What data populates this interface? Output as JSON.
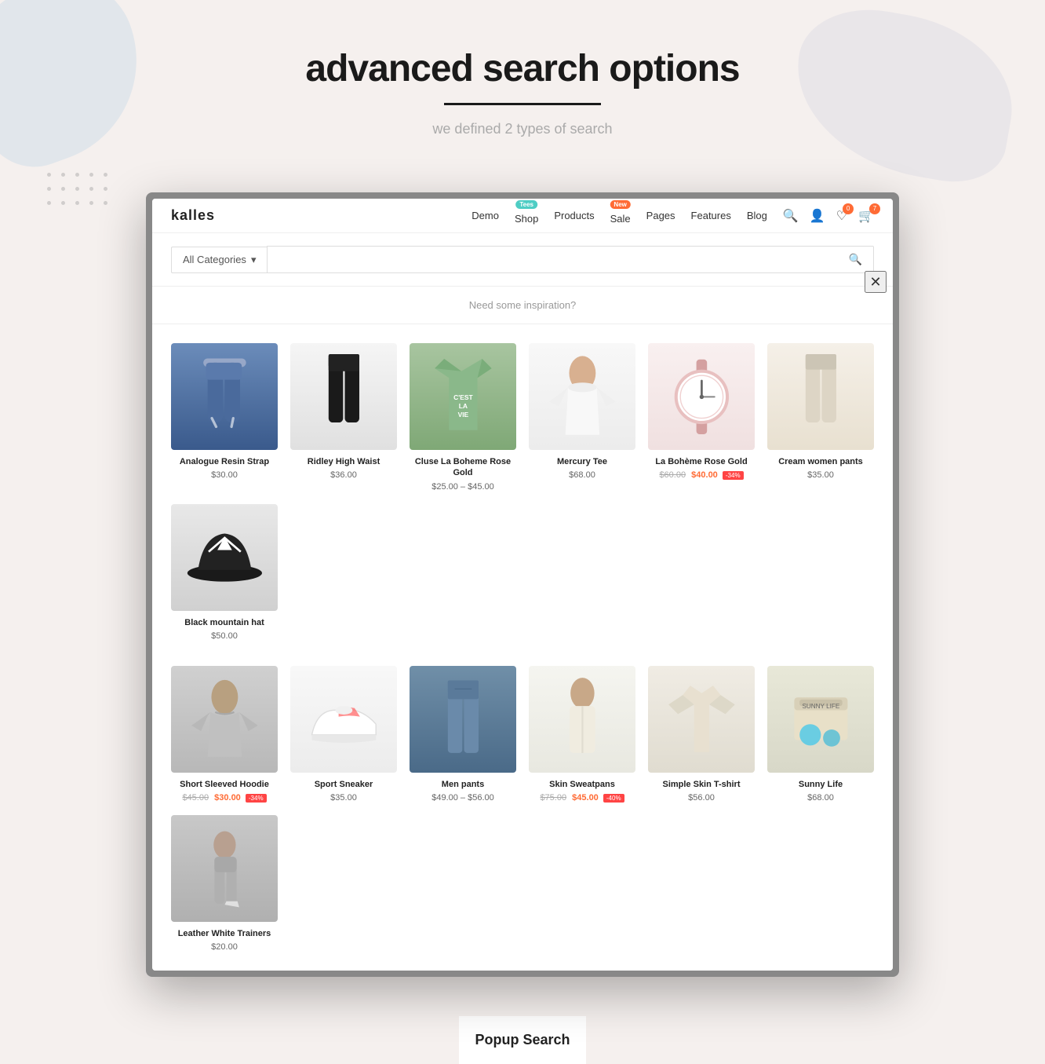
{
  "page": {
    "title": "advanced search  options",
    "underline": true,
    "subtitle": "we defined 2 types of search",
    "bottom_label": "Popup Search"
  },
  "navbar": {
    "logo": "kalles",
    "links": [
      {
        "label": "Demo",
        "badge": null
      },
      {
        "label": "Shop",
        "badge": {
          "text": "Tees",
          "color": "teal"
        }
      },
      {
        "label": "Products",
        "badge": null
      },
      {
        "label": "Sale",
        "badge": {
          "text": "New",
          "color": "orange"
        }
      },
      {
        "label": "Pages",
        "badge": null
      },
      {
        "label": "Features",
        "badge": null
      },
      {
        "label": "Blog",
        "badge": null
      }
    ],
    "icons": [
      {
        "name": "search",
        "count": null
      },
      {
        "name": "user",
        "count": null
      },
      {
        "name": "wishlist",
        "count": "0"
      },
      {
        "name": "cart",
        "count": "7"
      }
    ]
  },
  "search": {
    "category_placeholder": "All Categories",
    "input_placeholder": "",
    "inspiration_text": "Need some inspiration?"
  },
  "products_row1": [
    {
      "name": "Analogue Resin Strap",
      "price": "$30.00",
      "original_price": null,
      "sale_price": null,
      "discount": null,
      "img_style": "joggers-blue"
    },
    {
      "name": "Ridley High Waist",
      "price": "$36.00",
      "original_price": null,
      "sale_price": null,
      "discount": null,
      "img_style": "black-pants"
    },
    {
      "name": "Cluse La Boheme Rose Gold",
      "price": null,
      "original_price": "$25.00",
      "sale_price": "$45.00",
      "price_range": "$25.00 – $45.00",
      "discount": null,
      "img_style": "tshirt-green"
    },
    {
      "name": "Mercury Tee",
      "price": "$68.00",
      "original_price": null,
      "sale_price": null,
      "discount": null,
      "img_style": "white-top"
    },
    {
      "name": "La Bohème Rose Gold",
      "price": null,
      "original_price": "$60.00",
      "sale_price": "$40.00",
      "discount": "-34%",
      "img_style": "watch-pink"
    },
    {
      "name": "Cream women pants",
      "price": "$35.00",
      "original_price": null,
      "sale_price": null,
      "discount": null,
      "img_style": "cream-pants"
    },
    {
      "name": "Black mountain hat",
      "price": "$50.00",
      "original_price": null,
      "sale_price": null,
      "discount": null,
      "img_style": "black-hat"
    }
  ],
  "products_row2": [
    {
      "name": "Short Sleeved Hoodie",
      "price": null,
      "original_price": "$45.00",
      "sale_price": "$30.00",
      "discount": "-34%",
      "img_style": "grey-hoodie"
    },
    {
      "name": "Sport Sneaker",
      "price": "$35.00",
      "original_price": null,
      "sale_price": null,
      "discount": null,
      "img_style": "white-sneakers"
    },
    {
      "name": "Men pants",
      "price": null,
      "original_price": "$49.00",
      "sale_price": "$56.00",
      "price_range": "$49.00 – $56.00",
      "discount": null,
      "img_style": "blue-jeans"
    },
    {
      "name": "Skin Sweatpans",
      "price": null,
      "original_price": "$75.00",
      "sale_price": "$45.00",
      "discount": "-40%",
      "img_style": "white-pants"
    },
    {
      "name": "Simple Skin T-shirt",
      "price": "$56.00",
      "original_price": null,
      "sale_price": null,
      "discount": null,
      "img_style": "cream-tshirt"
    },
    {
      "name": "Sunny Life",
      "price": "$68.00",
      "original_price": null,
      "sale_price": null,
      "discount": null,
      "img_style": "blue-box"
    },
    {
      "name": "Leather White Trainers",
      "price": "$20.00",
      "original_price": null,
      "sale_price": null,
      "discount": null,
      "img_style": "grey-leggings"
    }
  ]
}
